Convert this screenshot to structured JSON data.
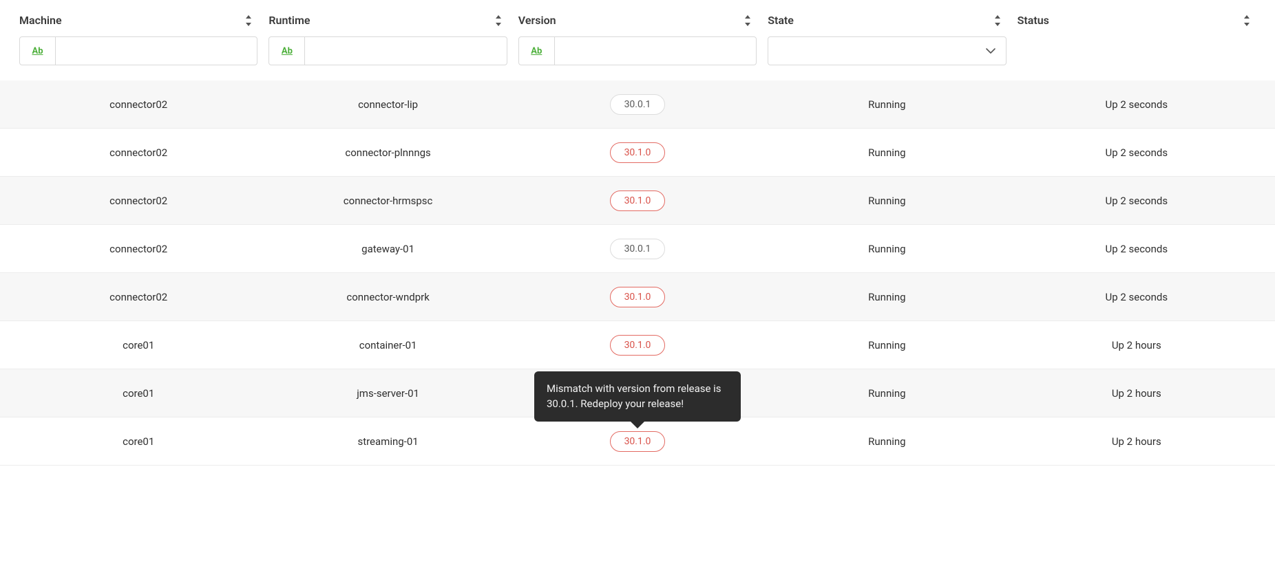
{
  "columns": {
    "machine": {
      "label": "Machine",
      "filter_prefix": "Ab",
      "filter_value": ""
    },
    "runtime": {
      "label": "Runtime",
      "filter_prefix": "Ab",
      "filter_value": ""
    },
    "version": {
      "label": "Version",
      "filter_prefix": "Ab",
      "filter_value": ""
    },
    "state": {
      "label": "State",
      "selected": ""
    },
    "status": {
      "label": "Status"
    }
  },
  "rows": [
    {
      "machine": "connector02",
      "runtime": "connector-lip",
      "version": "30.0.1",
      "version_warn": false,
      "state": "Running",
      "status": "Up 2 seconds"
    },
    {
      "machine": "connector02",
      "runtime": "connector-plnnngs",
      "version": "30.1.0",
      "version_warn": true,
      "state": "Running",
      "status": "Up 2 seconds"
    },
    {
      "machine": "connector02",
      "runtime": "connector-hrmspsc",
      "version": "30.1.0",
      "version_warn": true,
      "state": "Running",
      "status": "Up 2 seconds"
    },
    {
      "machine": "connector02",
      "runtime": "gateway-01",
      "version": "30.0.1",
      "version_warn": false,
      "state": "Running",
      "status": "Up 2 seconds"
    },
    {
      "machine": "connector02",
      "runtime": "connector-wndprk",
      "version": "30.1.0",
      "version_warn": true,
      "state": "Running",
      "status": "Up 2 seconds"
    },
    {
      "machine": "core01",
      "runtime": "container-01",
      "version": "30.1.0",
      "version_warn": true,
      "state": "Running",
      "status": "Up 2 hours"
    },
    {
      "machine": "core01",
      "runtime": "jms-server-01",
      "version": "",
      "version_warn": false,
      "state": "Running",
      "status": "Up 2 hours"
    },
    {
      "machine": "core01",
      "runtime": "streaming-01",
      "version": "30.1.0",
      "version_warn": true,
      "state": "Running",
      "status": "Up 2 hours"
    }
  ],
  "tooltip": {
    "text": "Mismatch with version from release is 30.0.1. Redeploy your release!",
    "for_row_index": 7
  }
}
